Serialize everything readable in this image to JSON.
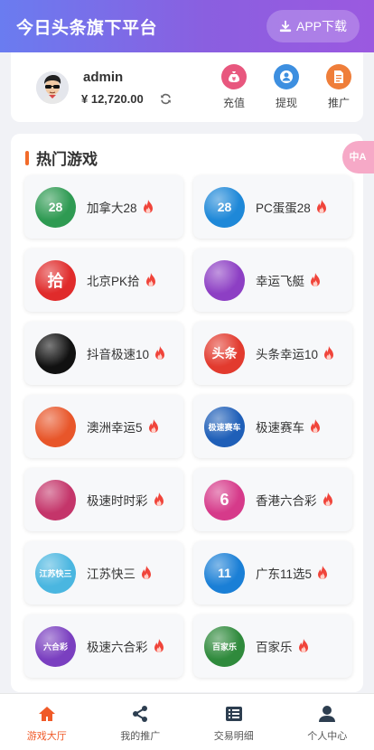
{
  "header": {
    "title": "今日头条旗下平台",
    "app_download_label": "APP下载"
  },
  "user": {
    "name": "admin",
    "balance": "¥ 12,720.00",
    "actions": [
      {
        "label": "充值",
        "icon": "money-bag-icon",
        "color": "#e8577e"
      },
      {
        "label": "提现",
        "icon": "user-card-icon",
        "color": "#3d8fe0"
      },
      {
        "label": "推广",
        "icon": "document-icon",
        "color": "#ef7e3a"
      }
    ]
  },
  "translate": {
    "label": "中A"
  },
  "games_section": {
    "title": "热门游戏",
    "accent_color": "#f26b2a",
    "games": [
      {
        "name": "加拿大28",
        "icon": "canada28-icon",
        "icon_text": "28",
        "color": "#2e9a52"
      },
      {
        "name": "PC蛋蛋28",
        "icon": "pc28-icon",
        "icon_text": "28",
        "color": "#1e88d8"
      },
      {
        "name": "北京PK拾",
        "icon": "pk10-icon",
        "icon_text": "拾",
        "color": "#e02b2b"
      },
      {
        "name": "幸运飞艇",
        "icon": "airship-icon",
        "icon_text": "",
        "color": "#8d3fc4"
      },
      {
        "name": "抖音极速10",
        "icon": "douyin-icon",
        "icon_text": "",
        "color": "#111111"
      },
      {
        "name": "头条幸运10",
        "icon": "toutiao-icon",
        "icon_text": "头条",
        "color": "#e23a2e"
      },
      {
        "name": "澳洲幸运5",
        "icon": "australia5-icon",
        "icon_text": "",
        "color": "#e8562a"
      },
      {
        "name": "极速赛车",
        "icon": "racing-icon",
        "icon_text": "极速赛车",
        "color": "#1f5fb8"
      },
      {
        "name": "极速时时彩",
        "icon": "ssc-icon",
        "icon_text": "",
        "color": "#c4356a"
      },
      {
        "name": "香港六合彩",
        "icon": "hk-lottery-icon",
        "icon_text": "6",
        "color": "#d63a8a"
      },
      {
        "name": "江苏快三",
        "icon": "jiangsu-k3-icon",
        "icon_text": "江苏快三",
        "color": "#4ab6e0"
      },
      {
        "name": "广东11选5",
        "icon": "gd11x5-icon",
        "icon_text": "11",
        "color": "#1a7fd6"
      },
      {
        "name": "极速六合彩",
        "icon": "fast-lhc-icon",
        "icon_text": "六合彩",
        "color": "#7a3fc0"
      },
      {
        "name": "百家乐",
        "icon": "baccarat-icon",
        "icon_text": "百家乐",
        "color": "#2f8a3c"
      }
    ]
  },
  "tabbar": {
    "active_color": "#f05a28",
    "items": [
      {
        "label": "游戏大厅",
        "icon": "home-icon",
        "active": true
      },
      {
        "label": "我的推广",
        "icon": "share-icon",
        "active": false
      },
      {
        "label": "交易明细",
        "icon": "list-icon",
        "active": false
      },
      {
        "label": "个人中心",
        "icon": "person-icon",
        "active": false
      }
    ]
  }
}
